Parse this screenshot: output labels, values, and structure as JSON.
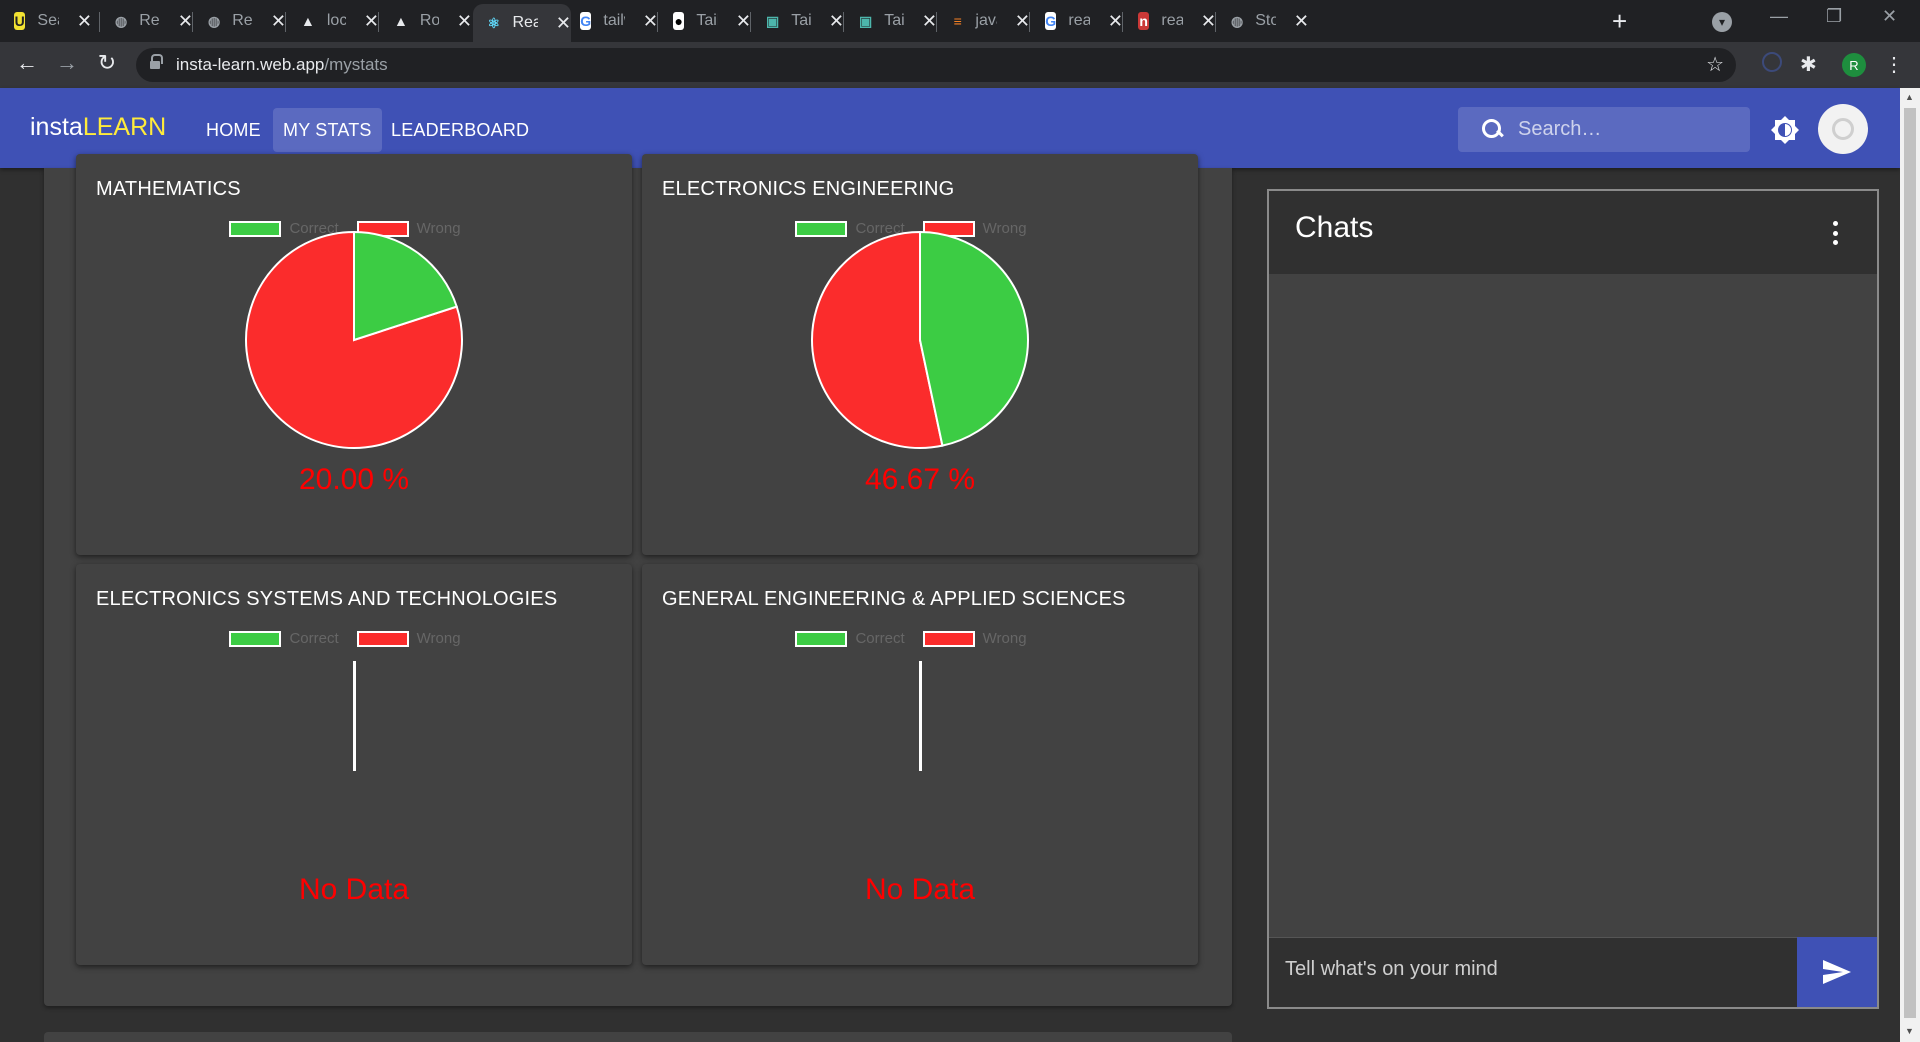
{
  "browser": {
    "tabs": [
      {
        "title": "Search",
        "icon": "yellow-app-icon",
        "active": false
      },
      {
        "title": "React",
        "icon": "globe-icon",
        "active": false
      },
      {
        "title": "React",
        "icon": "globe-icon",
        "active": false
      },
      {
        "title": "localhost",
        "icon": "triangle-icon",
        "active": false
      },
      {
        "title": "Rome",
        "icon": "triangle-icon",
        "active": false
      },
      {
        "title": "React",
        "icon": "react-icon",
        "active": true
      },
      {
        "title": "tailwind",
        "icon": "google-icon",
        "active": false
      },
      {
        "title": "Tailwind",
        "icon": "medium-icon",
        "active": false
      },
      {
        "title": "Tailwind",
        "icon": "book-icon",
        "active": false
      },
      {
        "title": "Tailwind",
        "icon": "book-icon",
        "active": false
      },
      {
        "title": "javascript",
        "icon": "stackoverflow-icon",
        "active": false
      },
      {
        "title": "react",
        "icon": "google-icon",
        "active": false
      },
      {
        "title": "react",
        "icon": "npm-icon",
        "active": false
      },
      {
        "title": "Story",
        "icon": "globe-icon",
        "active": false
      }
    ],
    "url_host": "insta-learn.web.app",
    "url_path": "/mystats",
    "profile_initial": "R"
  },
  "appbar": {
    "brand_prefix": "insta",
    "brand_highlight": "LEARN",
    "nav": [
      {
        "label": "HOME",
        "active": false
      },
      {
        "label": "MY STATS",
        "active": true
      },
      {
        "label": "LEADERBOARD",
        "active": false
      }
    ],
    "search_placeholder": "Search…"
  },
  "legend": {
    "correct": "Correct",
    "wrong": "Wrong"
  },
  "colors": {
    "correct": "#3ccc44",
    "wrong": "#fb2c2c",
    "accent": "#3f51b5",
    "percent": "#ff0000"
  },
  "cards": [
    {
      "title": "MATHEMATICS",
      "correct_fraction": 0.2,
      "result": "20.00 %"
    },
    {
      "title": "ELECTRONICS ENGINEERING",
      "correct_fraction": 0.4667,
      "result": "46.67 %"
    },
    {
      "title": "ELECTRONICS SYSTEMS AND TECHNOLOGIES",
      "correct_fraction": null,
      "result": "No Data"
    },
    {
      "title": "GENERAL ENGINEERING & APPLIED SCIENCES",
      "correct_fraction": null,
      "result": "No Data"
    }
  ],
  "chart_data": [
    {
      "type": "pie",
      "title": "MATHEMATICS",
      "categories": [
        "Correct",
        "Wrong"
      ],
      "values": [
        20.0,
        80.0
      ]
    },
    {
      "type": "pie",
      "title": "ELECTRONICS ENGINEERING",
      "categories": [
        "Correct",
        "Wrong"
      ],
      "values": [
        46.67,
        53.33
      ]
    },
    {
      "type": "pie",
      "title": "ELECTRONICS SYSTEMS AND TECHNOLOGIES",
      "categories": [
        "Correct",
        "Wrong"
      ],
      "values": []
    },
    {
      "type": "pie",
      "title": "GENERAL ENGINEERING & APPLIED SCIENCES",
      "categories": [
        "Correct",
        "Wrong"
      ],
      "values": []
    }
  ],
  "chats": {
    "title": "Chats",
    "input_placeholder": "Tell what's on your mind"
  }
}
